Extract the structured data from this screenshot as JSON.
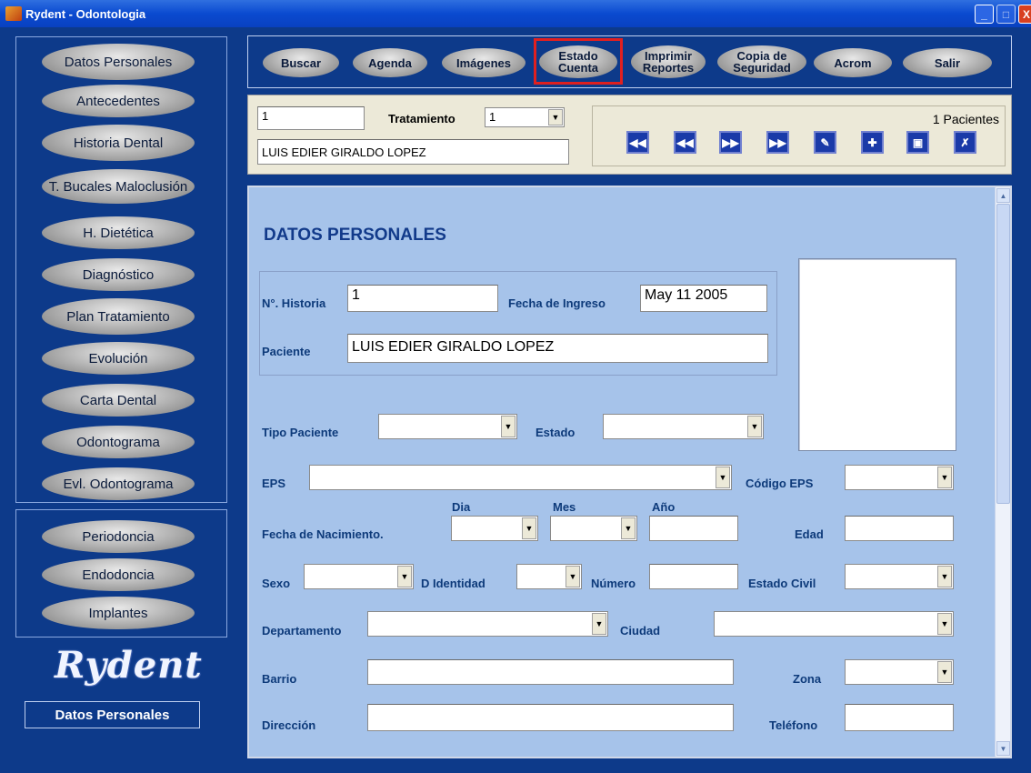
{
  "window": {
    "title": "Rydent - Odontologia",
    "min": "_",
    "max": "□",
    "close": "X"
  },
  "sidebar": {
    "items": [
      {
        "label": "Datos Personales"
      },
      {
        "label": "Antecedentes"
      },
      {
        "label": "Historia Dental"
      },
      {
        "label": "T. Bucales Maloclusión"
      },
      {
        "label": "H. Dietética"
      },
      {
        "label": "Diagnóstico"
      },
      {
        "label": "Plan Tratamiento"
      },
      {
        "label": "Evolución"
      },
      {
        "label": "Carta Dental"
      },
      {
        "label": "Odontograma"
      },
      {
        "label": "Evl. Odontograma"
      }
    ],
    "items2": [
      {
        "label": "Periodoncia"
      },
      {
        "label": "Endodoncia"
      },
      {
        "label": "Implantes"
      }
    ],
    "logo": "Rydent",
    "current_section": "Datos Personales"
  },
  "toolbar": {
    "buttons": [
      {
        "label": "Buscar"
      },
      {
        "label": "Agenda"
      },
      {
        "label": "Imágenes"
      },
      {
        "label": "Estado Cuenta"
      },
      {
        "label": "Imprimir Reportes"
      },
      {
        "label": "Copia de Seguridad"
      },
      {
        "label": "Acrom"
      },
      {
        "label": "Salir"
      }
    ]
  },
  "record": {
    "id": "1",
    "treatment_label": "Tratamiento",
    "treatment_value": "1",
    "patient_name": "LUIS EDIER GIRALDO LOPEZ",
    "count": "1 Pacientes",
    "nav": [
      "first-icon",
      "prev-icon",
      "next-icon",
      "last-icon",
      "edit-icon",
      "new-record-icon",
      "save-icon",
      "cancel-icon"
    ]
  },
  "form": {
    "section_title": "DATOS PERSONALES",
    "historia_label": "N°. Historia",
    "historia_value": "1",
    "fecha_ingreso_label": "Fecha de Ingreso",
    "fecha_ingreso_value": "May 11 2005",
    "paciente_label": "Paciente",
    "paciente_value": "LUIS EDIER GIRALDO LOPEZ",
    "tipo_paciente_label": "Tipo Paciente",
    "estado_label": "Estado",
    "eps_label": "EPS",
    "codigo_eps_label": "Código EPS",
    "dia_label": "Dia",
    "mes_label": "Mes",
    "anio_label": "Año",
    "fecha_nac_label": "Fecha de Nacimiento.",
    "edad_label": "Edad",
    "sexo_label": "Sexo",
    "d_identidad_label": "D Identidad",
    "numero_label": "Número",
    "estado_civil_label": "Estado Civil",
    "departamento_label": "Departamento",
    "ciudad_label": "Ciudad",
    "barrio_label": "Barrio",
    "zona_label": "Zona",
    "direccion_label": "Dirección",
    "telefono_label": "Teléfono"
  },
  "colors": {
    "accent": "#0d3a8a",
    "form_bg": "#a6c3ea",
    "label": "#123a8a",
    "highlight": "#e02020"
  }
}
